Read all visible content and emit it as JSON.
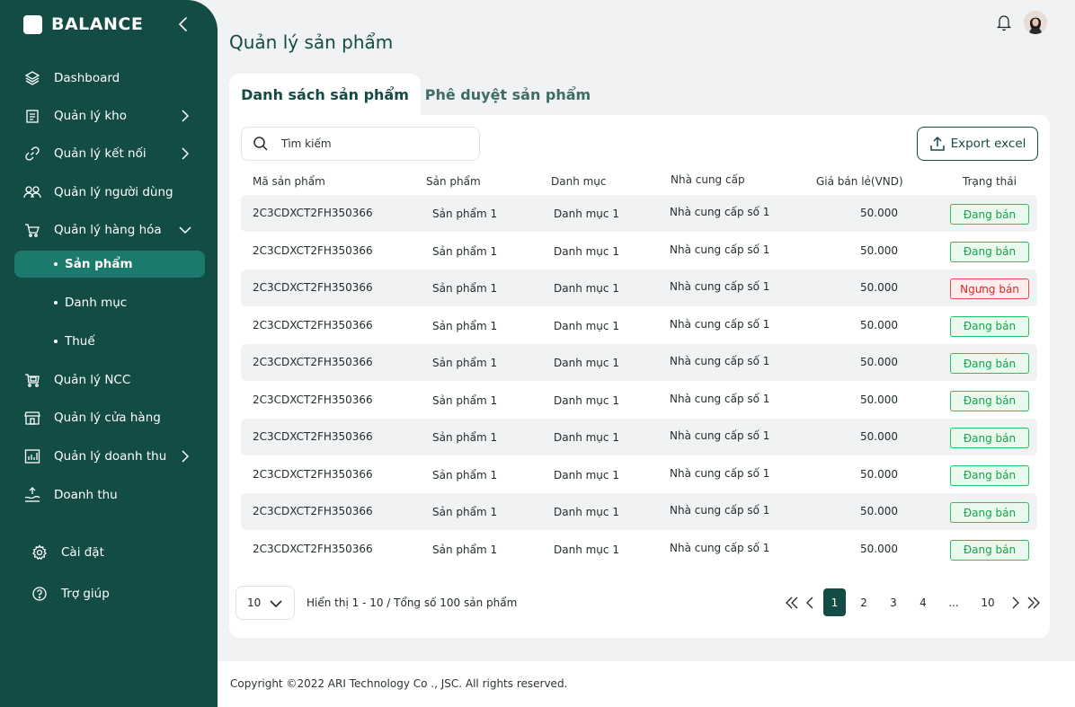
{
  "app": {
    "name": "BALANCE"
  },
  "sidebar": {
    "items": [
      {
        "label": "Dashboard",
        "icon": "layers-icon"
      },
      {
        "label": "Quản lý kho",
        "icon": "warehouse-icon"
      },
      {
        "label": "Quản lý kết nối",
        "icon": "link-icon"
      },
      {
        "label": "Quản lý người dùng",
        "icon": "users-icon"
      },
      {
        "label": "Quản lý hàng hóa",
        "icon": "cart-icon"
      },
      {
        "label": "Quản lý NCC",
        "icon": "supplier-icon"
      },
      {
        "label": "Quản lý cửa hàng",
        "icon": "store-icon"
      },
      {
        "label": "Quản lý doanh thu",
        "icon": "chart-icon"
      },
      {
        "label": "Doanh thu",
        "icon": "revenue-icon"
      },
      {
        "label": "Cài đặt",
        "icon": "gear-icon"
      },
      {
        "label": "Trợ giúp",
        "icon": "help-icon"
      }
    ],
    "sub_items": [
      {
        "label": "Sản phẩm",
        "active": true
      },
      {
        "label": "Danh mục",
        "active": false
      },
      {
        "label": "Thuế",
        "active": false
      }
    ]
  },
  "page": {
    "title": "Quản lý sản phẩm"
  },
  "tabs": [
    {
      "label": "Danh sách sản phẩm",
      "active": true
    },
    {
      "label": "Phê duyệt sản phẩm",
      "active": false
    }
  ],
  "search": {
    "placeholder": "Tìm kiếm"
  },
  "toolbar": {
    "export_label": "Export excel"
  },
  "table": {
    "columns": [
      "Mã sản phẩm",
      "Sản phẩm",
      "Danh mục",
      "Nhà cung cấp",
      "Giá bán lẻ(VND)",
      "Trạng thái"
    ],
    "rows": [
      {
        "code": "2C3CDXCT2FH350366",
        "product": "Sản phẩm 1",
        "category": "Danh mục 1",
        "supplier": "Nhà cung cấp số 1",
        "price": "50.000",
        "status": "Đang bán"
      },
      {
        "code": "2C3CDXCT2FH350366",
        "product": "Sản phẩm 1",
        "category": "Danh mục 1",
        "supplier": "Nhà cung cấp số 1",
        "price": "50.000",
        "status": "Đang bán"
      },
      {
        "code": "2C3CDXCT2FH350366",
        "product": "Sản phẩm 1",
        "category": "Danh mục 1",
        "supplier": "Nhà cung cấp số 1",
        "price": "50.000",
        "status": "Ngưng bán"
      },
      {
        "code": "2C3CDXCT2FH350366",
        "product": "Sản phẩm 1",
        "category": "Danh mục 1",
        "supplier": "Nhà cung cấp số 1",
        "price": "50.000",
        "status": "Đang bán"
      },
      {
        "code": "2C3CDXCT2FH350366",
        "product": "Sản phẩm 1",
        "category": "Danh mục 1",
        "supplier": "Nhà cung cấp số 1",
        "price": "50.000",
        "status": "Đang bán"
      },
      {
        "code": "2C3CDXCT2FH350366",
        "product": "Sản phẩm 1",
        "category": "Danh mục 1",
        "supplier": "Nhà cung cấp số 1",
        "price": "50.000",
        "status": "Đang bán"
      },
      {
        "code": "2C3CDXCT2FH350366",
        "product": "Sản phẩm 1",
        "category": "Danh mục 1",
        "supplier": "Nhà cung cấp số 1",
        "price": "50.000",
        "status": "Đang bán"
      },
      {
        "code": "2C3CDXCT2FH350366",
        "product": "Sản phẩm 1",
        "category": "Danh mục 1",
        "supplier": "Nhà cung cấp số 1",
        "price": "50.000",
        "status": "Đang bán"
      },
      {
        "code": "2C3CDXCT2FH350366",
        "product": "Sản phẩm 1",
        "category": "Danh mục 1",
        "supplier": "Nhà cung cấp số 1",
        "price": "50.000",
        "status": "Đang bán"
      },
      {
        "code": "2C3CDXCT2FH350366",
        "product": "Sản phẩm 1",
        "category": "Danh mục 1",
        "supplier": "Nhà cung cấp số 1",
        "price": "50.000",
        "status": "Đang bán"
      }
    ]
  },
  "pagination": {
    "page_size": "10",
    "summary": "Hiển thị 1 - 10 / Tổng số 100 sản phẩm",
    "pages": [
      "1",
      "2",
      "3",
      "4",
      "...",
      "10"
    ],
    "current": "1"
  },
  "footer": {
    "copyright": "Copyright ©2022 ARI Technology Co ., JSC. All rights reserved."
  },
  "colors": {
    "primary": "#124c45",
    "active_item": "#1c7a6c",
    "success": "#16a34a",
    "danger": "#dc2626"
  }
}
